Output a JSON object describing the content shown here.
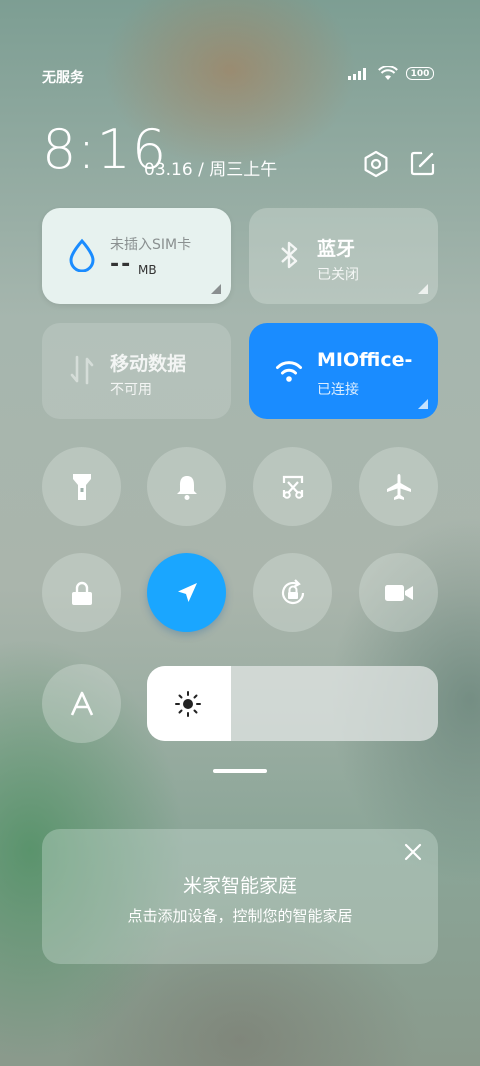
{
  "status_bar": {
    "carrier": "无服务",
    "battery": "100"
  },
  "header": {
    "time": "8:16",
    "date": "03.16 / 周三上午"
  },
  "tiles": {
    "sim": {
      "label": "未插入SIM卡",
      "value": "--",
      "unit": "MB"
    },
    "bluetooth": {
      "title": "蓝牙",
      "status": "已关闭"
    },
    "mobile_data": {
      "title": "移动数据",
      "status": "不可用"
    },
    "wifi": {
      "title": "MIOffice-",
      "status": "已连接"
    }
  },
  "toggles": [
    {
      "icon": "flashlight-icon",
      "active": false
    },
    {
      "icon": "bell-icon",
      "active": false
    },
    {
      "icon": "screenshot-icon",
      "active": false
    },
    {
      "icon": "airplane-icon",
      "active": false
    },
    {
      "icon": "lock-icon",
      "active": false
    },
    {
      "icon": "location-icon",
      "active": true
    },
    {
      "icon": "rotation-lock-icon",
      "active": false
    },
    {
      "icon": "video-camera-icon",
      "active": false
    },
    {
      "icon": "font-a-icon",
      "active": false
    }
  ],
  "brightness": {
    "level": 0.29
  },
  "mihome": {
    "title": "米家智能家庭",
    "subtitle": "点击添加设备，控制您的智能家居"
  },
  "colors": {
    "accent_blue": "#1a8cff",
    "location_blue": "#1aa6ff",
    "water_drop": "#1a8cff"
  }
}
